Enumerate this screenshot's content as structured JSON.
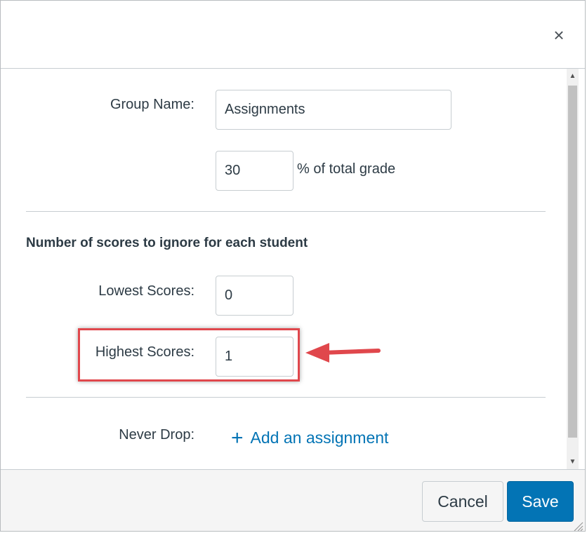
{
  "dialog": {
    "close_symbol": "×"
  },
  "form": {
    "group_name_label": "Group Name:",
    "group_name_value": "Assignments",
    "weight_value": "30",
    "weight_suffix": "% of total grade",
    "drop_section_heading": "Number of scores to ignore for each student",
    "lowest_label": "Lowest Scores:",
    "lowest_value": "0",
    "highest_label": "Highest Scores:",
    "highest_value": "1",
    "never_drop_label": "Never Drop:",
    "add_assignment_label": "Add an assignment",
    "add_icon": "plus-icon"
  },
  "footer": {
    "cancel_label": "Cancel",
    "save_label": "Save"
  },
  "colors": {
    "accent": "#0374b5",
    "highlight": "#e0474c",
    "text": "#2d3b45",
    "border": "#c7cdd1"
  }
}
